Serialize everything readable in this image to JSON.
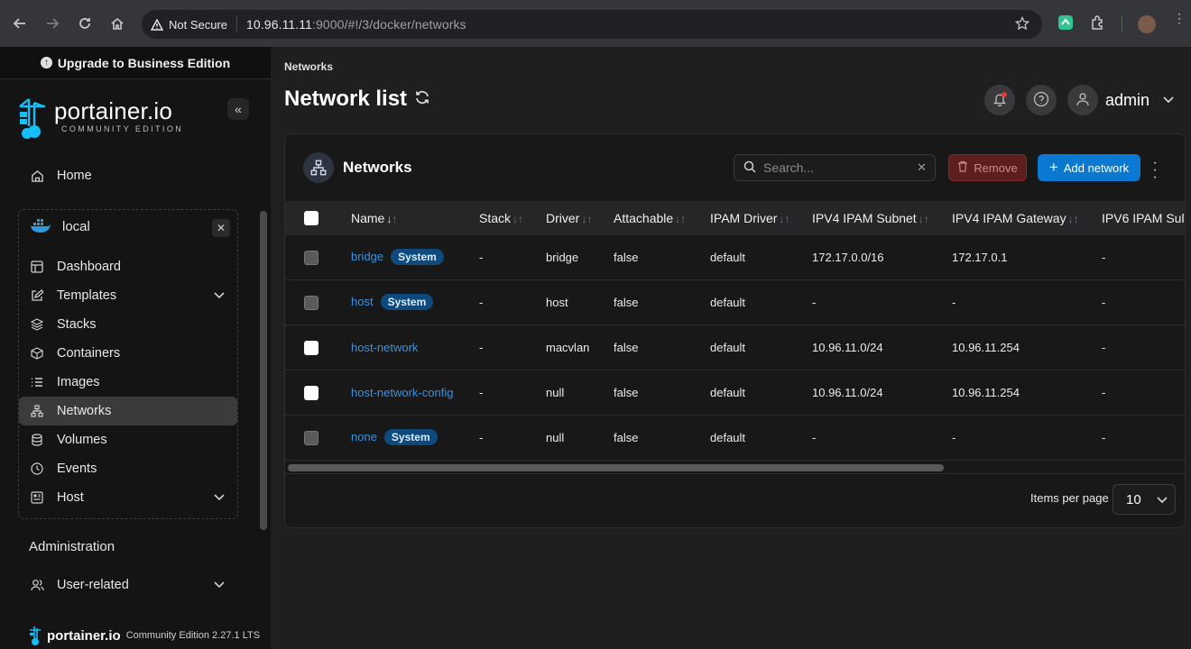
{
  "browser": {
    "security_label": "Not Secure",
    "url_host": "10.96.11.11",
    "url_rest": ":9000/#!/3/docker/networks"
  },
  "sidebar": {
    "upgrade_label": "Upgrade to Business Edition",
    "logo_text": "portainer.io",
    "logo_subtext": "COMMUNITY EDITION",
    "home_label": "Home",
    "environment": {
      "name": "local",
      "items": [
        {
          "label": "Dashboard",
          "icon": "dashboard-icon"
        },
        {
          "label": "Templates",
          "icon": "edit-icon",
          "expandable": true
        },
        {
          "label": "Stacks",
          "icon": "layers-icon"
        },
        {
          "label": "Containers",
          "icon": "box-icon"
        },
        {
          "label": "Images",
          "icon": "list-icon"
        },
        {
          "label": "Networks",
          "icon": "network-icon",
          "active": true
        },
        {
          "label": "Volumes",
          "icon": "database-icon"
        },
        {
          "label": "Events",
          "icon": "clock-icon"
        },
        {
          "label": "Host",
          "icon": "host-icon",
          "expandable": true
        }
      ]
    },
    "admin_heading": "Administration",
    "user_related_label": "User-related",
    "footer_brand": "portainer.io",
    "footer_edition": "Community Edition 2.27.1 LTS"
  },
  "header": {
    "breadcrumb": "Networks",
    "title": "Network list",
    "username": "admin"
  },
  "networks_card": {
    "title": "Networks",
    "search_placeholder": "Search...",
    "remove_label": "Remove",
    "add_label": "Add network",
    "columns": [
      "Name",
      "Stack",
      "Driver",
      "Attachable",
      "IPAM Driver",
      "IPV4 IPAM Subnet",
      "IPV4 IPAM Gateway",
      "IPV6 IPAM Sul"
    ],
    "system_badge": "System",
    "rows": [
      {
        "name": "bridge",
        "system": true,
        "stack": "-",
        "driver": "bridge",
        "attachable": "false",
        "ipam_driver": "default",
        "subnet": "172.17.0.0/16",
        "gateway": "172.17.0.1",
        "ipv6": "-"
      },
      {
        "name": "host",
        "system": true,
        "stack": "-",
        "driver": "host",
        "attachable": "false",
        "ipam_driver": "default",
        "subnet": "-",
        "gateway": "-",
        "ipv6": "-"
      },
      {
        "name": "host-network",
        "system": false,
        "stack": "-",
        "driver": "macvlan",
        "attachable": "false",
        "ipam_driver": "default",
        "subnet": "10.96.11.0/24",
        "gateway": "10.96.11.254",
        "ipv6": "-"
      },
      {
        "name": "host-network-config",
        "system": false,
        "stack": "-",
        "driver": "null",
        "attachable": "false",
        "ipam_driver": "default",
        "subnet": "10.96.11.0/24",
        "gateway": "10.96.11.254",
        "ipv6": "-"
      },
      {
        "name": "none",
        "system": true,
        "stack": "-",
        "driver": "null",
        "attachable": "false",
        "ipam_driver": "default",
        "subnet": "-",
        "gateway": "-",
        "ipv6": "-"
      }
    ],
    "items_per_page_label": "Items per page",
    "items_per_page_value": "10"
  },
  "colors": {
    "accent": "#0b78d2",
    "link": "#3a92e0",
    "badge": "#0e4a7e",
    "danger": "#5e1e1e"
  }
}
